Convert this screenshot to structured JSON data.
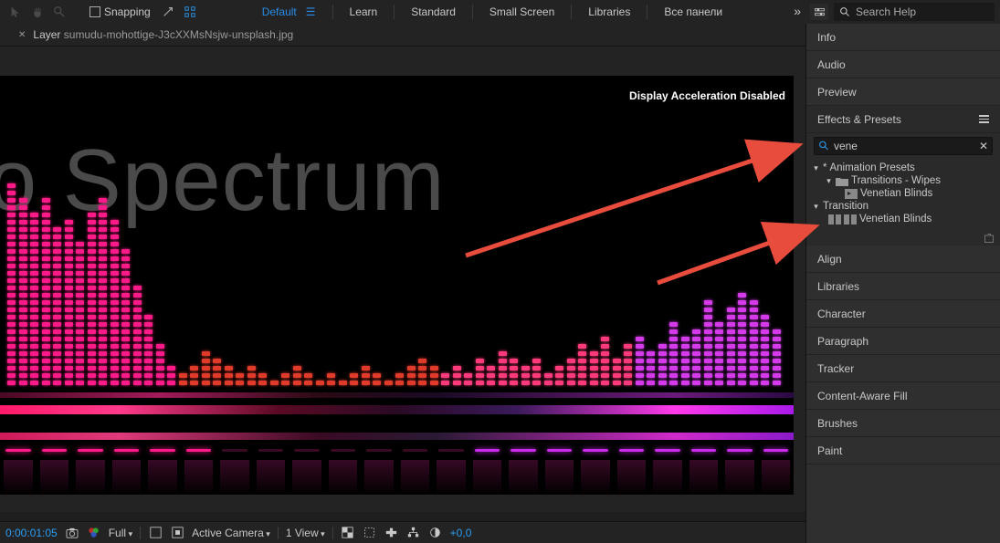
{
  "topbar": {
    "snapping_label": "Snapping",
    "workspaces": [
      "Default",
      "Learn",
      "Standard",
      "Small Screen",
      "Libraries",
      "Все панели"
    ],
    "search_help_placeholder": "Search Help"
  },
  "tab": {
    "prefix": "Layer",
    "filename": "sumudu-mohottige-J3cXXMsNsjw-unsplash.jpg"
  },
  "viewer": {
    "accel_msg": "Display Acceleration Disabled",
    "spectrum_text": "dio Spectrum"
  },
  "controlbar": {
    "timecode": "0:00:01:05",
    "mag": "Full",
    "camera": "Active Camera",
    "views": "1 View",
    "offset": "+0,0"
  },
  "right_panels": {
    "info": "Info",
    "audio": "Audio",
    "preview": "Preview",
    "effects": {
      "title": "Effects & Presets",
      "search_value": "vene",
      "tree": {
        "animation_presets": "Animation Presets",
        "transitions_wipes": "Transitions - Wipes",
        "venetian_blinds_preset": "Venetian Blinds",
        "transition": "Transition",
        "venetian_blinds_effect": "Venetian Blinds"
      }
    },
    "align": "Align",
    "libraries": "Libraries",
    "character": "Character",
    "paragraph": "Paragraph",
    "tracker": "Tracker",
    "caf": "Content-Aware Fill",
    "brushes": "Brushes",
    "paint": "Paint"
  }
}
